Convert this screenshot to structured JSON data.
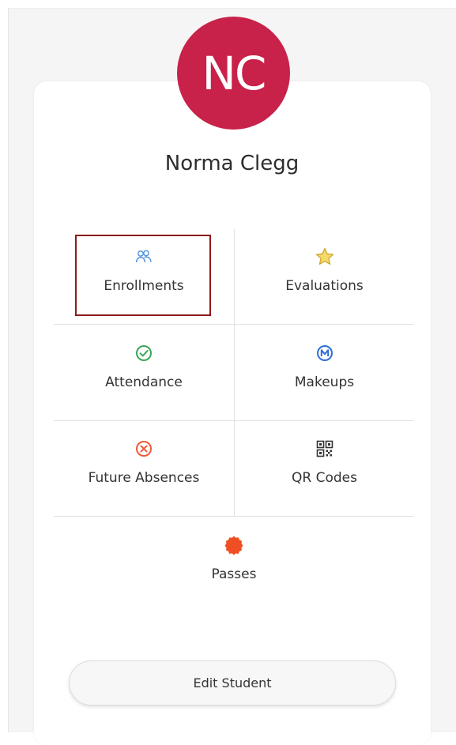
{
  "student": {
    "initials": "NC",
    "name": "Norma Clegg",
    "avatar_color": "#c8224a"
  },
  "menu": {
    "selected": "Enrollments",
    "items": [
      {
        "label": "Enrollments",
        "icon": "people-icon",
        "color": "#4a90d9"
      },
      {
        "label": "Evaluations",
        "icon": "star-icon",
        "color": "#f2c94c"
      },
      {
        "label": "Attendance",
        "icon": "check-circle-icon",
        "color": "#3aa757"
      },
      {
        "label": "Makeups",
        "icon": "makeup-m-icon",
        "color": "#2f6fd6"
      },
      {
        "label": "Future Absences",
        "icon": "x-circle-icon",
        "color": "#ef5a3a"
      },
      {
        "label": "QR Codes",
        "icon": "qr-code-icon",
        "color": "#333333"
      },
      {
        "label": "Passes",
        "icon": "pass-badge-icon",
        "color": "#f04e23"
      }
    ]
  },
  "actions": {
    "edit_label": "Edit Student"
  }
}
